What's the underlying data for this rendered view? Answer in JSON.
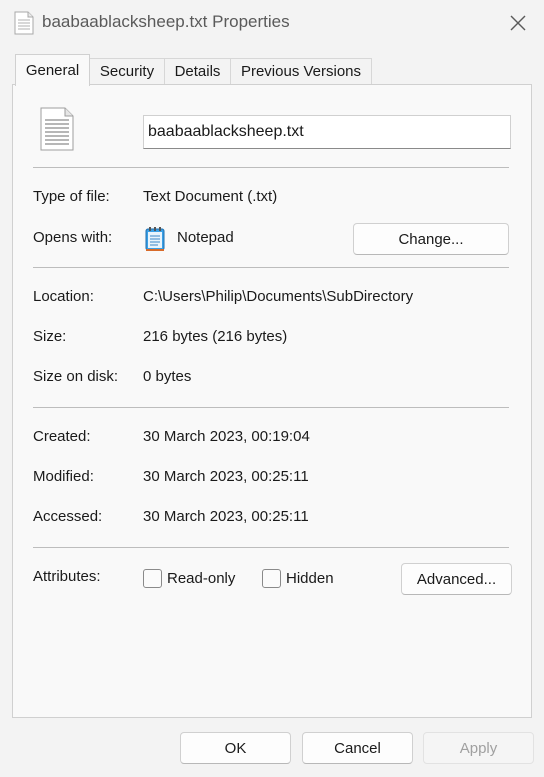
{
  "window": {
    "title": "baabaablacksheep.txt Properties",
    "close_icon": "close-icon",
    "file_icon": "text-file-icon"
  },
  "tabs": [
    {
      "label": "General",
      "active": true
    },
    {
      "label": "Security",
      "active": false
    },
    {
      "label": "Details",
      "active": false
    },
    {
      "label": "Previous Versions",
      "active": false
    }
  ],
  "general": {
    "file_name": "baabaablacksheep.txt",
    "type_label": "Type of file:",
    "type_value": "Text Document (.txt)",
    "opens_label": "Opens with:",
    "opens_value": "Notepad",
    "opens_icon": "notepad-icon",
    "change_button": "Change...",
    "location_label": "Location:",
    "location_value": "C:\\Users\\Philip\\Documents\\SubDirectory",
    "size_label": "Size:",
    "size_value": "216 bytes (216 bytes)",
    "size_on_disk_label": "Size on disk:",
    "size_on_disk_value": "0 bytes",
    "created_label": "Created:",
    "created_value": "30 March 2023, 00:19:04",
    "modified_label": "Modified:",
    "modified_value": "30 March 2023, 00:25:11",
    "accessed_label": "Accessed:",
    "accessed_value": "30 March 2023, 00:25:11",
    "attributes_label": "Attributes:",
    "readonly_label": "Read-only",
    "readonly_checked": false,
    "hidden_label": "Hidden",
    "hidden_checked": false,
    "advanced_button": "Advanced..."
  },
  "footer": {
    "ok": "OK",
    "cancel": "Cancel",
    "apply": "Apply",
    "apply_disabled": true
  },
  "colors": {
    "window_bg": "#f3f3f3",
    "panel_bg": "#f9f9f9",
    "separator": "#bdbdbd",
    "disabled_text": "#a0a0a0"
  }
}
